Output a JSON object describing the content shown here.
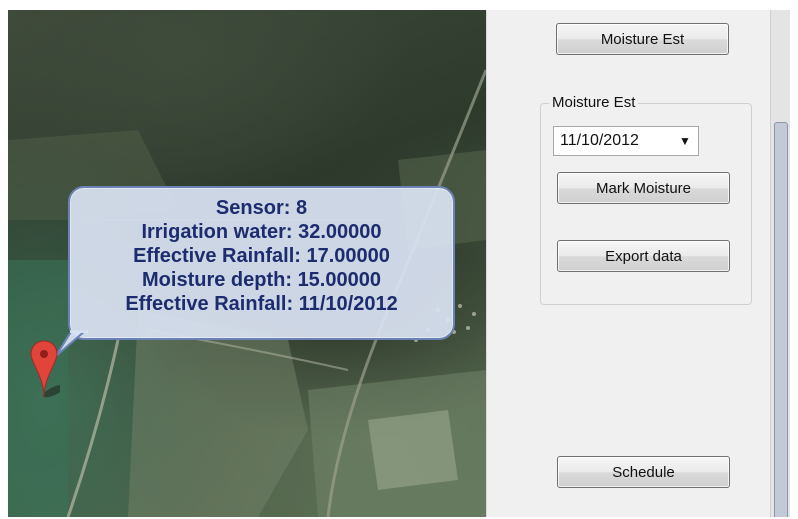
{
  "map": {
    "info_balloon": {
      "sensor": "Sensor: 8",
      "irrigation_water": "Irrigation water: 32.00000",
      "effective_rainfall": "Effective Rainfall: 17.00000",
      "moisture_depth": "Moisture depth: 15.00000",
      "effective_rainfall_date": "Effective Rainfall: 11/10/2012"
    },
    "marker_icon": "map-pin-icon",
    "marker_color": "#e0443a"
  },
  "panel": {
    "moisture_est_button": "Moisture Est",
    "group": {
      "legend": "Moisture Est",
      "date_value": "11/10/2012",
      "mark_moisture_button": "Mark Moisture",
      "export_data_button": "Export data"
    },
    "schedule_button": "Schedule"
  }
}
